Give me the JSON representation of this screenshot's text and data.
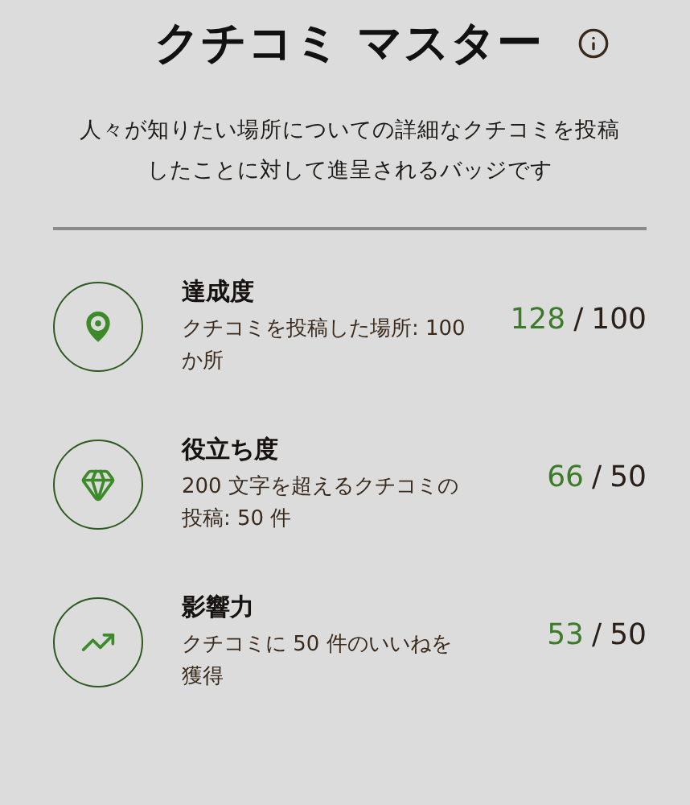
{
  "title": "クチコミ マスター",
  "description_lines": [
    "人々が知りたい場所についての詳細なクチコミを投稿",
    "したことに対して進呈されるバッジです"
  ],
  "criteria": [
    {
      "kind": "location",
      "name": "達成度",
      "detail": "クチコミを投稿した場所: 100 か所",
      "current": "128",
      "separator": "/",
      "target": "100"
    },
    {
      "kind": "gem",
      "name": "役立ち度",
      "detail": "200 文字を超えるクチコミの投稿: 50 件",
      "current": "66",
      "separator": "/",
      "target": "50"
    },
    {
      "kind": "trend",
      "name": "影響力",
      "detail": "クチコミに 50 件のいいねを獲得",
      "current": "53",
      "separator": "/",
      "target": "50"
    }
  ]
}
